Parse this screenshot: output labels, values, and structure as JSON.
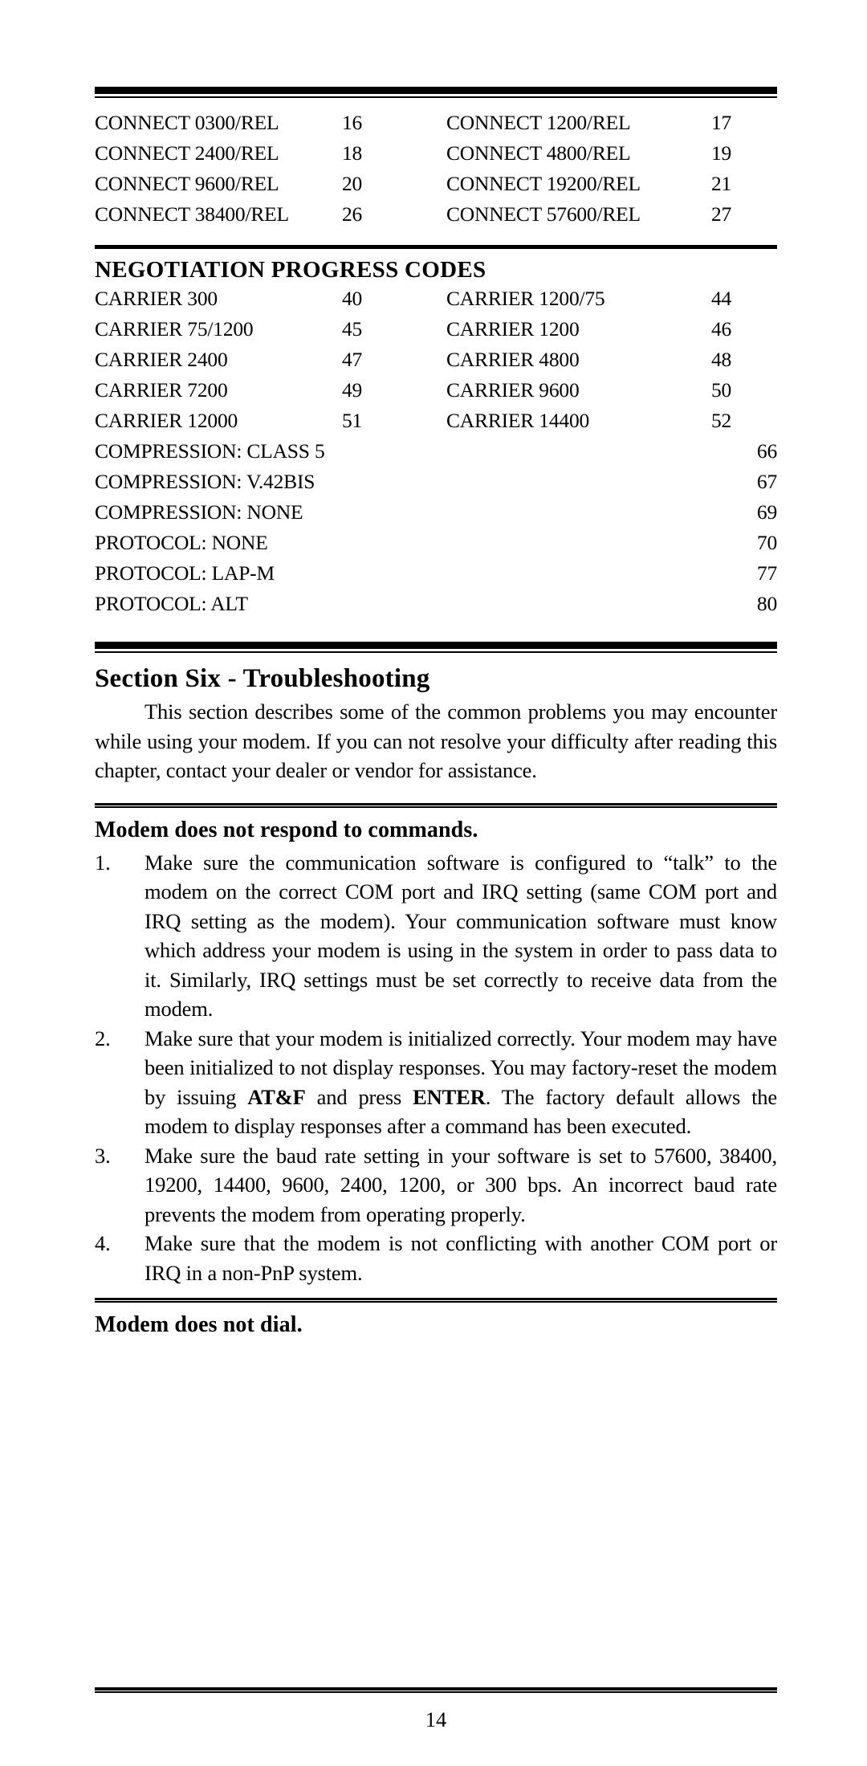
{
  "page": {
    "number": "14"
  },
  "connect_codes": {
    "rows": [
      {
        "left_label": "CONNECT 0300/REL",
        "left_code": "16",
        "right_label": "CONNECT 1200/REL",
        "right_code": "17"
      },
      {
        "left_label": "CONNECT 2400/REL",
        "left_code": "18",
        "right_label": "CONNECT 4800/REL",
        "right_code": "19"
      },
      {
        "left_label": "CONNECT 9600/REL",
        "left_code": "20",
        "right_label": "CONNECT 19200/REL",
        "right_code": "21"
      },
      {
        "left_label": "CONNECT 38400/REL",
        "left_code": "26",
        "right_label": "CONNECT 57600/REL",
        "right_code": "27"
      }
    ]
  },
  "negotiation": {
    "title": "NEGOTIATION  PROGRESS  CODES",
    "carrier_rows": [
      {
        "left_label": "CARRIER 300",
        "left_code": "40",
        "right_label": "CARRIER 1200/75",
        "right_code": "44"
      },
      {
        "left_label": "CARRIER 75/1200",
        "left_code": "45",
        "right_label": "CARRIER 1200",
        "right_code": "46"
      },
      {
        "left_label": "CARRIER 2400",
        "left_code": "47",
        "right_label": "CARRIER 4800",
        "right_code": "48"
      },
      {
        "left_label": "CARRIER 7200",
        "left_code": "49",
        "right_label": "CARRIER 9600",
        "right_code": "50"
      },
      {
        "left_label": "CARRIER 12000",
        "left_code": "51",
        "right_label": "CARRIER 14400",
        "right_code": "52"
      }
    ],
    "wide_rows": [
      {
        "label": "COMPRESSION: CLASS 5",
        "code": "66"
      },
      {
        "label": "COMPRESSION: V.42BIS",
        "code": "67"
      },
      {
        "label": "COMPRESSION: NONE",
        "code": "69"
      },
      {
        "label": "PROTOCOL: NONE",
        "code": "70"
      },
      {
        "label": "PROTOCOL: LAP-M",
        "code": "77"
      },
      {
        "label": "PROTOCOL: ALT",
        "code": "80"
      }
    ]
  },
  "section": {
    "title": "Section Six - Troubleshooting",
    "intro": "This section describes some of the common problems you may encounter while using your modem. If you can not resolve your difficulty after reading this chapter, contact your dealer or vendor for assistance."
  },
  "problem_1": {
    "heading": "Modem does not respond to commands.",
    "steps": [
      {
        "num": "1.",
        "text": "Make sure the communication software is configured to “talk” to the modem on the correct COM port and IRQ setting (same COM port and IRQ setting as the modem). Your communication software must know which address your modem is using in the system in order to pass data to it. Similarly, IRQ settings must be set correctly to receive data from the modem."
      },
      {
        "num": "2.",
        "text_before": "Make sure that your modem is initialized correctly. Your modem may have been initialized to not display responses. You may factory-reset the modem by issuing ",
        "bold_1": "AT&F",
        "text_middle": " and press ",
        "bold_2": "ENTER",
        "text_after": ". The factory default allows the modem to display responses after a command has been executed."
      },
      {
        "num": "3.",
        "text": "Make sure the baud rate setting in your software is set to 57600, 38400, 19200, 14400, 9600, 2400, 1200, or 300 bps. An incorrect baud rate prevents the modem from operating properly."
      },
      {
        "num": "4.",
        "text": "Make sure that the modem is not conflicting with another COM port or IRQ in a non-PnP system."
      }
    ]
  },
  "problem_2": {
    "heading": "Modem does not dial."
  }
}
